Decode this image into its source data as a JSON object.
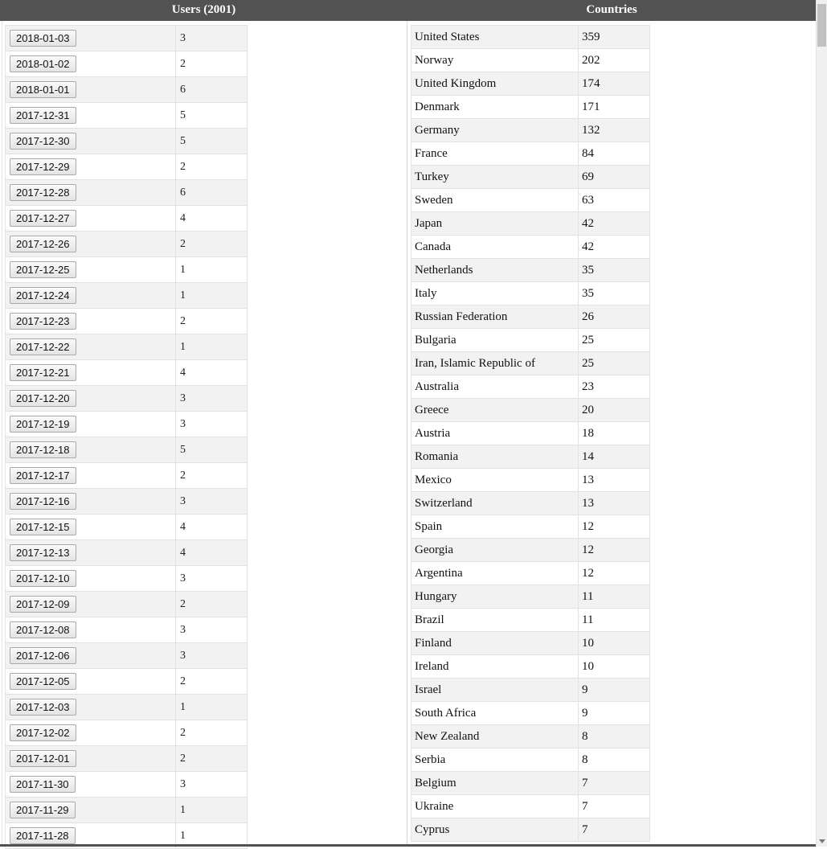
{
  "header": {
    "users_title": "Users (2001)",
    "countries_title": "Countries"
  },
  "users": [
    {
      "date": "2018-01-03",
      "count": "3"
    },
    {
      "date": "2018-01-02",
      "count": "2"
    },
    {
      "date": "2018-01-01",
      "count": "6"
    },
    {
      "date": "2017-12-31",
      "count": "5"
    },
    {
      "date": "2017-12-30",
      "count": "5"
    },
    {
      "date": "2017-12-29",
      "count": "2"
    },
    {
      "date": "2017-12-28",
      "count": "6"
    },
    {
      "date": "2017-12-27",
      "count": "4"
    },
    {
      "date": "2017-12-26",
      "count": "2"
    },
    {
      "date": "2017-12-25",
      "count": "1"
    },
    {
      "date": "2017-12-24",
      "count": "1"
    },
    {
      "date": "2017-12-23",
      "count": "2"
    },
    {
      "date": "2017-12-22",
      "count": "1"
    },
    {
      "date": "2017-12-21",
      "count": "4"
    },
    {
      "date": "2017-12-20",
      "count": "3"
    },
    {
      "date": "2017-12-19",
      "count": "3"
    },
    {
      "date": "2017-12-18",
      "count": "5"
    },
    {
      "date": "2017-12-17",
      "count": "2"
    },
    {
      "date": "2017-12-16",
      "count": "3"
    },
    {
      "date": "2017-12-15",
      "count": "4"
    },
    {
      "date": "2017-12-13",
      "count": "4"
    },
    {
      "date": "2017-12-10",
      "count": "3"
    },
    {
      "date": "2017-12-09",
      "count": "2"
    },
    {
      "date": "2017-12-08",
      "count": "3"
    },
    {
      "date": "2017-12-06",
      "count": "3"
    },
    {
      "date": "2017-12-05",
      "count": "2"
    },
    {
      "date": "2017-12-03",
      "count": "1"
    },
    {
      "date": "2017-12-02",
      "count": "2"
    },
    {
      "date": "2017-12-01",
      "count": "2"
    },
    {
      "date": "2017-11-30",
      "count": "3"
    },
    {
      "date": "2017-11-29",
      "count": "1"
    },
    {
      "date": "2017-11-28",
      "count": "1"
    }
  ],
  "countries": [
    {
      "name": "United States",
      "count": "359"
    },
    {
      "name": "Norway",
      "count": "202"
    },
    {
      "name": "United Kingdom",
      "count": "174"
    },
    {
      "name": "Denmark",
      "count": "171"
    },
    {
      "name": "Germany",
      "count": "132"
    },
    {
      "name": "France",
      "count": "84"
    },
    {
      "name": "Turkey",
      "count": "69"
    },
    {
      "name": "Sweden",
      "count": "63"
    },
    {
      "name": "Japan",
      "count": "42"
    },
    {
      "name": "Canada",
      "count": "42"
    },
    {
      "name": "Netherlands",
      "count": "35"
    },
    {
      "name": "Italy",
      "count": "35"
    },
    {
      "name": "Russian Federation",
      "count": "26"
    },
    {
      "name": "Bulgaria",
      "count": "25"
    },
    {
      "name": "Iran, Islamic Republic of",
      "count": "25"
    },
    {
      "name": "Australia",
      "count": "23"
    },
    {
      "name": "Greece",
      "count": "20"
    },
    {
      "name": "Austria",
      "count": "18"
    },
    {
      "name": "Romania",
      "count": "14"
    },
    {
      "name": "Mexico",
      "count": "13"
    },
    {
      "name": "Switzerland",
      "count": "13"
    },
    {
      "name": "Spain",
      "count": "12"
    },
    {
      "name": "Georgia",
      "count": "12"
    },
    {
      "name": "Argentina",
      "count": "12"
    },
    {
      "name": "Hungary",
      "count": "11"
    },
    {
      "name": "Brazil",
      "count": "11"
    },
    {
      "name": "Finland",
      "count": "10"
    },
    {
      "name": "Ireland",
      "count": "10"
    },
    {
      "name": "Israel",
      "count": "9"
    },
    {
      "name": "South Africa",
      "count": "9"
    },
    {
      "name": "New Zealand",
      "count": "8"
    },
    {
      "name": "Serbia",
      "count": "8"
    },
    {
      "name": "Belgium",
      "count": "7"
    },
    {
      "name": "Ukraine",
      "count": "7"
    },
    {
      "name": "Cyprus",
      "count": "7"
    }
  ]
}
